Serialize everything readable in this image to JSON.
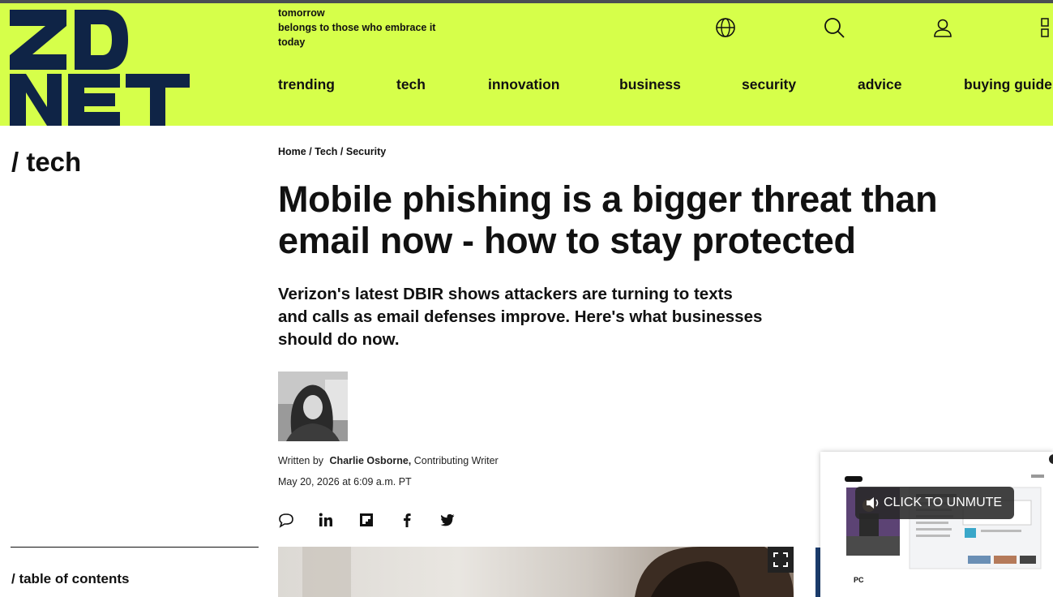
{
  "brand": {
    "logo_text": "ZDNET",
    "tagline": [
      "tomorrow",
      "belongs to those who embrace it",
      "today"
    ],
    "accent": "#d6ff4a",
    "logo_color": "#0f2446"
  },
  "header_icons": [
    "globe-icon",
    "search-icon",
    "user-icon",
    "menu-icon"
  ],
  "nav": {
    "items": [
      "trending",
      "tech",
      "innovation",
      "business",
      "security",
      "advice",
      "buying guide"
    ]
  },
  "section": {
    "label": "/ tech"
  },
  "breadcrumb": {
    "items": [
      "Home",
      "Tech",
      "Security"
    ],
    "separator": "/"
  },
  "article": {
    "headline": "Mobile phishing is a bigger threat than email now - how to stay protected",
    "subheadline": "Verizon's latest DBIR shows attackers are turning to texts and calls as email defenses improve. Here's what businesses should do now.",
    "byline_prefix": "Written by",
    "author": "Charlie Osborne,",
    "author_role": "Contributing Writer",
    "date": "May 20, 2026 at 6:09 a.m. PT"
  },
  "share": [
    "comment-icon",
    "linkedin-icon",
    "flipboard-icon",
    "facebook-icon",
    "twitter-icon"
  ],
  "toc": {
    "label": "/ table of contents"
  },
  "video": {
    "unmute_label": "CLICK TO UNMUTE",
    "thumb_label": "PC"
  }
}
